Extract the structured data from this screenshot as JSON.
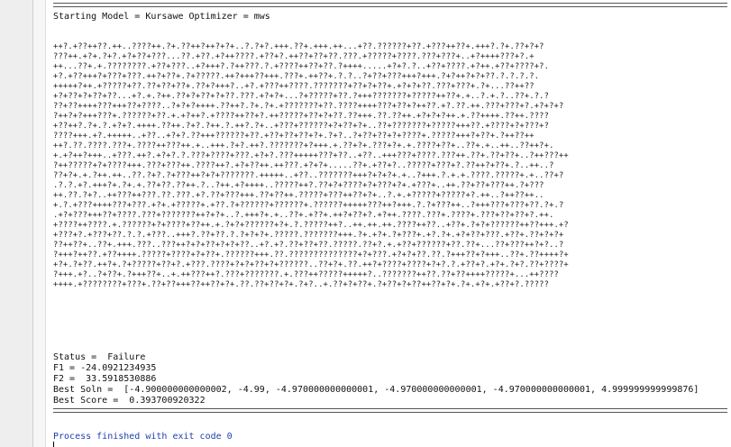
{
  "console": {
    "header": "Starting Model = Kursawe Optimizer = mws",
    "noise_lines": [
      "++?.+??++??.++..????++.?+.??++?++?+?+..?.?+?.+++.??+.+++.++...+??.??????+??.+???++??+.+++?.?+.??+?+?",
      "???++.+?+.?+?.+?+??+???...??.+??.+?++????.+??+?.++??+??+??.???.+?????+????.???+???+..+?++++???+?.+",
      "++...??+.+.????????.+??+???..+?+++?.?++???.?.+????++??+??.?++++.....+?+?.?..+??+????.+?++.+??+????+?.",
      "+?.+??+++?+???+???.++?+??+.?+?????.++?+++??+++.???+.++??+.?.?..?+??+???+++?+++.?+?++?+?+??.?.?.?.?.",
      "+++++?++.+?????+??.??+??+??+.??+?+++?..+?.+???++????.???????+??+?+??+.+?+?+??.???+???+.?+...??++??",
      "+?+??+?+??+??...+?.+.?++.??+?+??+?+??.???.+?+?+...?+?????+??.?+++???????+?????++??+.+..?.+.?..??+.?.?",
      "??+??++++???+++??+????..?+?+?++++.??++?.?+.?+.+???????+??.????++++???+??+?++??.+?.??.++.???+???+?.+?+?+?",
      "?++?+?+++???+.??????+??.+.+?++?.+????++??+?.++?????+??+?+??.??+++.??.??++.+?+?+?++.+.??++++.??++.????",
      "+??++?.?+.?.+?+?.++++.??++.?+?.?++.?.++?.?+..+???+??????+?+??+?+..??+???????+?????+++??.+????+?+???+?",
      "????+++.+?.+++++..+??..+?+?.??+++??????+??.+??+??+??+?+.?+?..?+??+??+?+????+.?????+++?+??+.?++??++",
      "++?.??.????.???+.????++???++.+..+++.?+?.++?.???????+?+++.+.??+?+.???+?+.+.????+??+..??+.+..++..??++?+.",
      "+.+?++?+++..+???.++?.+?+?.?.???+????+???.+?+?.???+++++???+??..+??..+++???+????.???++.??+.??+??+..?++???++",
      "?++?????+?+????+++.???+???++.????++?.+?+??++.++???.+?+?+.....??+.+??+?..?????+???+?.??++?+??+.?..++..?",
      "??+?+.+.?++.++..??.?+?.?+???++?+?+???????.+++++..+??..???????+++?+?+?+.+..?+++.?.+.+.????.?????+.+..??+?",
      ".?.?.+?.+++?+.?+.+.??+??.??++.?..?++.+?++++..?????++?.??+?+????+?+???+?+.+???+..++.??+??+???++.?+???",
      "++.??.?+?..++???++???.??.???.+?.??+???+++.??+??++.?????+???++??+?+..?.+.+?????+?????+?.++..?++??++..",
      "+.?.+???++++???+???.+?+.+?????+.+??.?+??????+??????+.??????+++++???++?+++.?.?+???++..?+++???+???+??.?+.?",
      ".+?+???+++??+????.???+???????++?+?+..?.+++?+.+..??+.+??+.++?+??+?.+?++.????.???+.????+.???+??+??+?.++.",
      "+????++????.+.??????+?+????+??++.+.?+?+??????+?+.?.?????++?..++.++.++.????++??..+??+.?+?+??????++??+++.+?",
      "+???+?.+???+??.?.?.+???..+++?.??+??.?.?+?+?+.?????.???????+++.?+.+?+.?+???+.+?.?+.+?+??+???.+??+.??+?+?+",
      "??++??+..??+.+++.???..???++?+?+??+?+?+??..+?.+?.??+??+??.?????.??+?.+.+??+??????+??.??+...??+???++?+?..?",
      "?+++?++??.+??++++.?????+????+?+??+.??????+++.??.??????????????+?+???.+?+?+??.??.?+++??+?+++..??+.??++++?+",
      "+?+.?+??.++?+.?+?????+??+?.+???.????+?+?+??+?+??????..??+?+.??.++?+????+????+?+?.?.+??+?.+?+.?+?.??+????+",
      "?+++.+?..?+??+.?+++??+..+.++???++?.???+???????.+.???++?????+++++?..???????++??.??+??++++?????+...++????",
      "++++.+????????+???+.??+??+++??++??+?+.??.??+??+?+.?+?..+.??+?+??+.?+??+?+??++??+?+.?+.+?+.+??+?.?????"
    ],
    "status_label": "Status =",
    "status_value": "Failure",
    "f1_label": "F1 =",
    "f1_value": "-24.0921234935",
    "f2_label": "F2 =",
    "f2_value": "33.5918530886",
    "best_soln_label": "Best Soln =",
    "best_soln_value": "[-4.900000000000002, -4.99, -4.970000000000001, -4.970000000000001, -4.970000000000001, 4.999999999999876]",
    "best_score_label": "Best Score =",
    "best_score_value": "0.393700920322",
    "exit_message": "Process finished with exit code 0"
  }
}
